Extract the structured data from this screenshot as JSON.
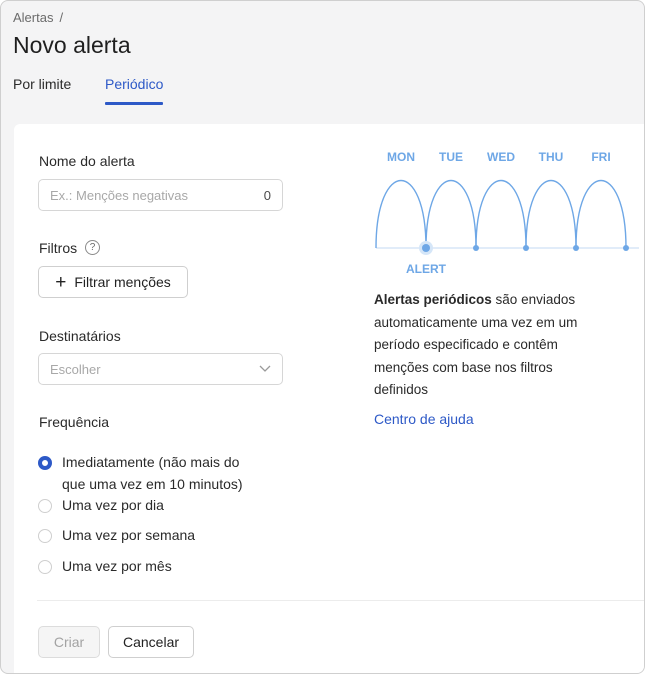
{
  "breadcrumb": {
    "parent": "Alertas",
    "separator": "/"
  },
  "page_title": "Novo alerta",
  "tabs": [
    {
      "label": "Por limite",
      "active": false
    },
    {
      "label": "Periódico",
      "active": true
    }
  ],
  "form": {
    "name_label": "Nome do alerta",
    "name_placeholder": "Ex.: Menções negativas",
    "name_counter": "0",
    "filters_label": "Filtros",
    "filters_help": "?",
    "filter_button": "Filtrar menções",
    "filter_button_icon": "plus-icon",
    "recipients_label": "Destinatários",
    "recipients_placeholder": "Escolher",
    "recipients_icon": "chevron-down-icon",
    "frequency_label": "Frequência",
    "frequency_options": [
      {
        "line1": "Imediatamente (não mais do",
        "line2": "que uma vez em 10 minutos)",
        "checked": true
      },
      {
        "line1": "Uma vez por dia",
        "checked": false
      },
      {
        "line1": "Uma vez por semana",
        "checked": false
      },
      {
        "line1": "Uma vez por mês",
        "checked": false
      }
    ]
  },
  "illustration": {
    "days": [
      "MON",
      "TUE",
      "WED",
      "THU",
      "FRI"
    ],
    "marker_label": "ALERT",
    "color": "#6ea7e6"
  },
  "description": {
    "bold": "Alertas periódicos",
    "rest": " são enviados automaticamente uma vez em um período especificado e contêm menções com base nos filtros definidos"
  },
  "help_link": "Centro de ajuda",
  "actions": {
    "create": "Criar",
    "create_disabled": true,
    "cancel": "Cancelar"
  },
  "colors": {
    "accent": "#2d59c7",
    "illustration": "#6ea7e6"
  }
}
